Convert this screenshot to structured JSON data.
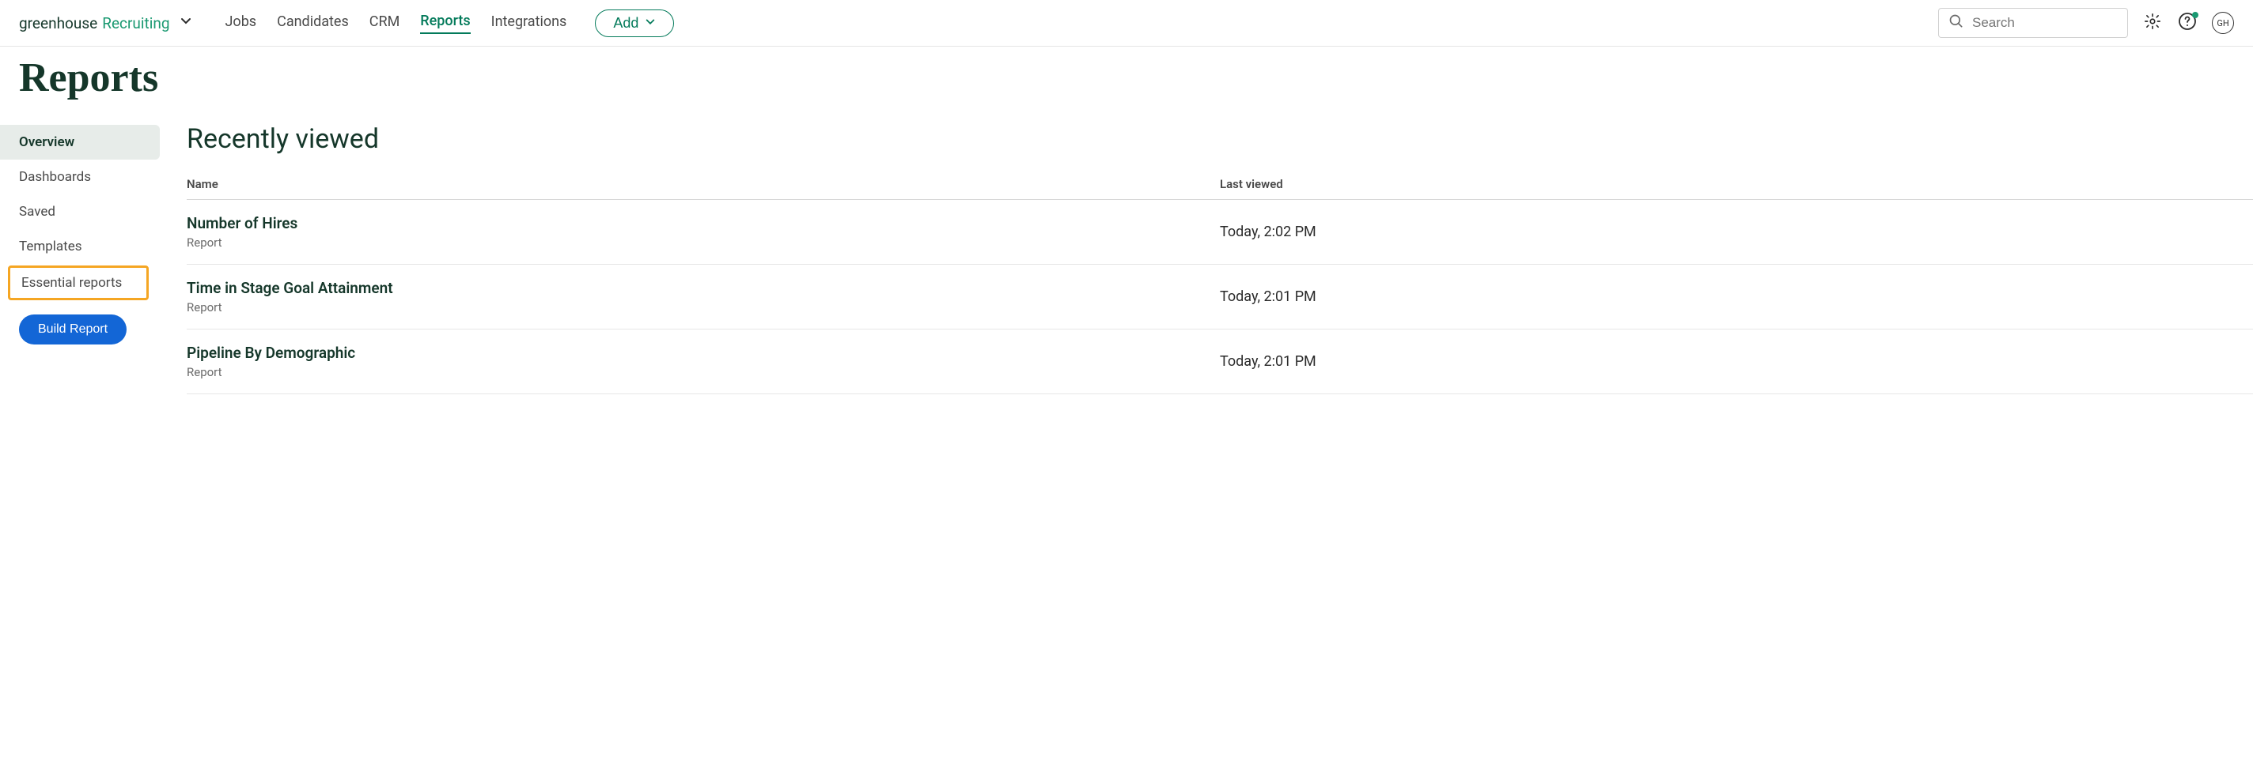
{
  "logo": {
    "text1": "greenhouse",
    "text2": "Recruiting"
  },
  "nav": {
    "items": [
      {
        "label": "Jobs",
        "active": false
      },
      {
        "label": "Candidates",
        "active": false
      },
      {
        "label": "CRM",
        "active": false
      },
      {
        "label": "Reports",
        "active": true
      },
      {
        "label": "Integrations",
        "active": false
      }
    ],
    "add_label": "Add"
  },
  "search": {
    "placeholder": "Search"
  },
  "avatar": {
    "initials": "GH"
  },
  "page": {
    "title": "Reports"
  },
  "sidebar": {
    "items": [
      {
        "label": "Overview",
        "active": true
      },
      {
        "label": "Dashboards"
      },
      {
        "label": "Saved"
      },
      {
        "label": "Templates"
      },
      {
        "label": "Essential reports",
        "highlighted": true
      }
    ],
    "build_label": "Build Report"
  },
  "section": {
    "title": "Recently viewed",
    "columns": {
      "name": "Name",
      "viewed": "Last viewed"
    },
    "rows": [
      {
        "title": "Number of Hires",
        "subtitle": "Report",
        "viewed": "Today, 2:02 PM"
      },
      {
        "title": "Time in Stage Goal Attainment",
        "subtitle": "Report",
        "viewed": "Today, 2:01 PM"
      },
      {
        "title": "Pipeline By Demographic",
        "subtitle": "Report",
        "viewed": "Today, 2:01 PM"
      }
    ]
  }
}
